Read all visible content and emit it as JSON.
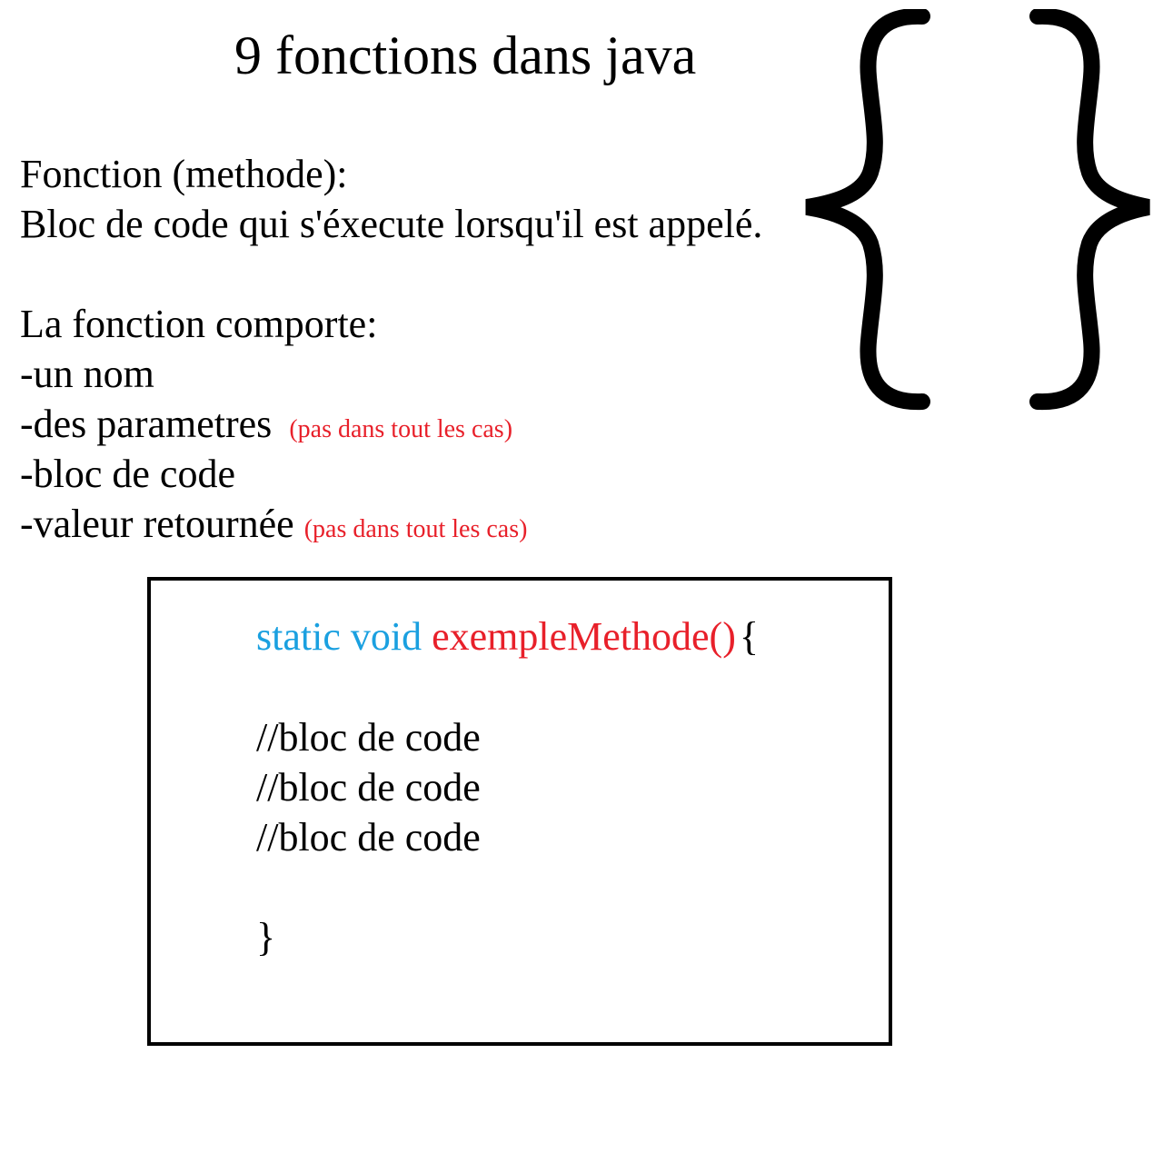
{
  "title": "9 fonctions dans java",
  "definition": {
    "heading": "Fonction (methode):",
    "text": "Bloc de code qui s'éxecute lorsqu'il est appelé."
  },
  "components": {
    "heading": "La fonction comporte:",
    "items": [
      {
        "label": "-un nom",
        "note": ""
      },
      {
        "label": "-des parametres",
        "note": "(pas dans tout les cas)"
      },
      {
        "label": "-bloc de code",
        "note": ""
      },
      {
        "label": "-valeur retournée",
        "note": "(pas dans tout les cas)"
      }
    ]
  },
  "code_example": {
    "keyword_static": "static",
    "keyword_void": "void",
    "method_name": "exempleMethode()",
    "open_brace": "{",
    "body_lines": [
      "//bloc de code",
      "//bloc de code",
      "//bloc de code"
    ],
    "close_brace": "}"
  },
  "colors": {
    "keyword": "#1aa0e0",
    "method": "#e8202a",
    "note": "#e8202a",
    "text": "#000000"
  },
  "decoration": {
    "icon": "curly-braces-icon"
  }
}
